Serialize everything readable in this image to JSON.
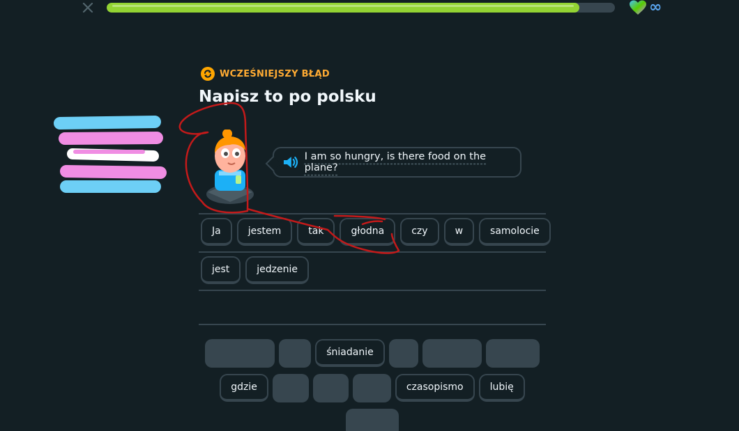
{
  "header": {
    "close_icon": "close-icon",
    "progress_percent": 93,
    "heart_icon": "heart-icon",
    "hearts_value": "∞"
  },
  "lesson": {
    "mistake_label": "WCZEŚNIEJSZY BŁĄD",
    "mistake_icon": "refresh-icon",
    "title": "Napisz to po polsku",
    "prompt": "I am so hungry, is there food on the plane?",
    "speaker_icon": "speaker-icon"
  },
  "answer": {
    "row1": [
      "Ja",
      "jestem",
      "tak",
      "głodna",
      "czy",
      "w",
      "samolocie"
    ],
    "row2": [
      "jest",
      "jedzenie"
    ]
  },
  "word_bank": {
    "row1": [
      {
        "label": "",
        "used": true
      },
      {
        "label": "",
        "used": true
      },
      {
        "label": "śniadanie",
        "used": false
      },
      {
        "label": "",
        "used": true
      },
      {
        "label": "",
        "used": true
      },
      {
        "label": "",
        "used": true
      }
    ],
    "row2": [
      {
        "label": "gdzie",
        "used": false
      },
      {
        "label": "",
        "used": true
      },
      {
        "label": "",
        "used": true
      },
      {
        "label": "",
        "used": true
      },
      {
        "label": "czasopismo",
        "used": false
      },
      {
        "label": "lubię",
        "used": false
      }
    ],
    "row3": [
      {
        "label": "",
        "used": true
      }
    ]
  },
  "colors": {
    "background": "#131f24",
    "progress": "#93d333",
    "accent_orange": "#ffab33",
    "chip_border": "#37464f",
    "annotation_red": "#c41a1a",
    "flag_blue": "#6dcff6",
    "flag_pink": "#f08de3"
  }
}
